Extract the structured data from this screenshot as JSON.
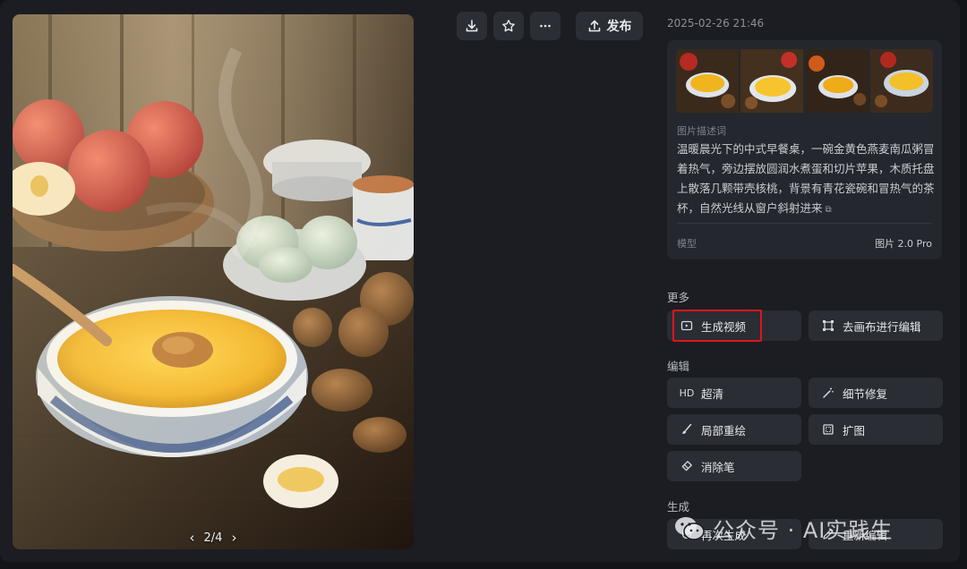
{
  "toolbar": {
    "download_icon": "download-icon",
    "favorite_icon": "star-icon",
    "more_icon": "ellipsis-icon",
    "publish_label": "发布"
  },
  "image_viewer": {
    "pager_text": "2/4",
    "prev_icon": "chevron-left-icon",
    "next_icon": "chevron-right-icon"
  },
  "details": {
    "timestamp": "2025-02-26 21:46",
    "thumbnail_count": 4,
    "description_label": "图片描述词",
    "description_text": "温暖晨光下的中式早餐桌，一碗金黄色燕麦南瓜粥冒着热气，旁边摆放圆润水煮蛋和切片苹果，木质托盘上散落几颗带壳核桃，背景有青花瓷碗和冒热气的茶杯，自然光线从窗户斜射进来",
    "copy_icon": "copy-icon",
    "model_label": "模型",
    "model_value": "图片 2.0 Pro"
  },
  "sections": {
    "more": {
      "title": "更多",
      "actions": [
        {
          "label": "生成视频",
          "icon": "video-icon"
        },
        {
          "label": "去画布进行编辑",
          "icon": "canvas-icon"
        }
      ]
    },
    "edit": {
      "title": "编辑",
      "actions": [
        {
          "label": "超清",
          "icon": "hd-icon",
          "icon_text": "HD"
        },
        {
          "label": "细节修复",
          "icon": "magic-wand-icon"
        },
        {
          "label": "局部重绘",
          "icon": "brush-icon"
        },
        {
          "label": "扩图",
          "icon": "expand-icon"
        },
        {
          "label": "消除笔",
          "icon": "eraser-icon"
        }
      ]
    },
    "generate": {
      "title": "生成",
      "actions": [
        {
          "label": "再次生成",
          "icon": "refresh-icon"
        },
        {
          "label": "重新编辑",
          "icon": "pencil-icon"
        }
      ]
    }
  },
  "watermark": {
    "text": "公众号 · AI实践生",
    "icon": "wechat-icon"
  },
  "colors": {
    "background": "#1b1d22",
    "card": "#24272d",
    "button": "#2a2d33",
    "highlight": "#e0141b"
  }
}
